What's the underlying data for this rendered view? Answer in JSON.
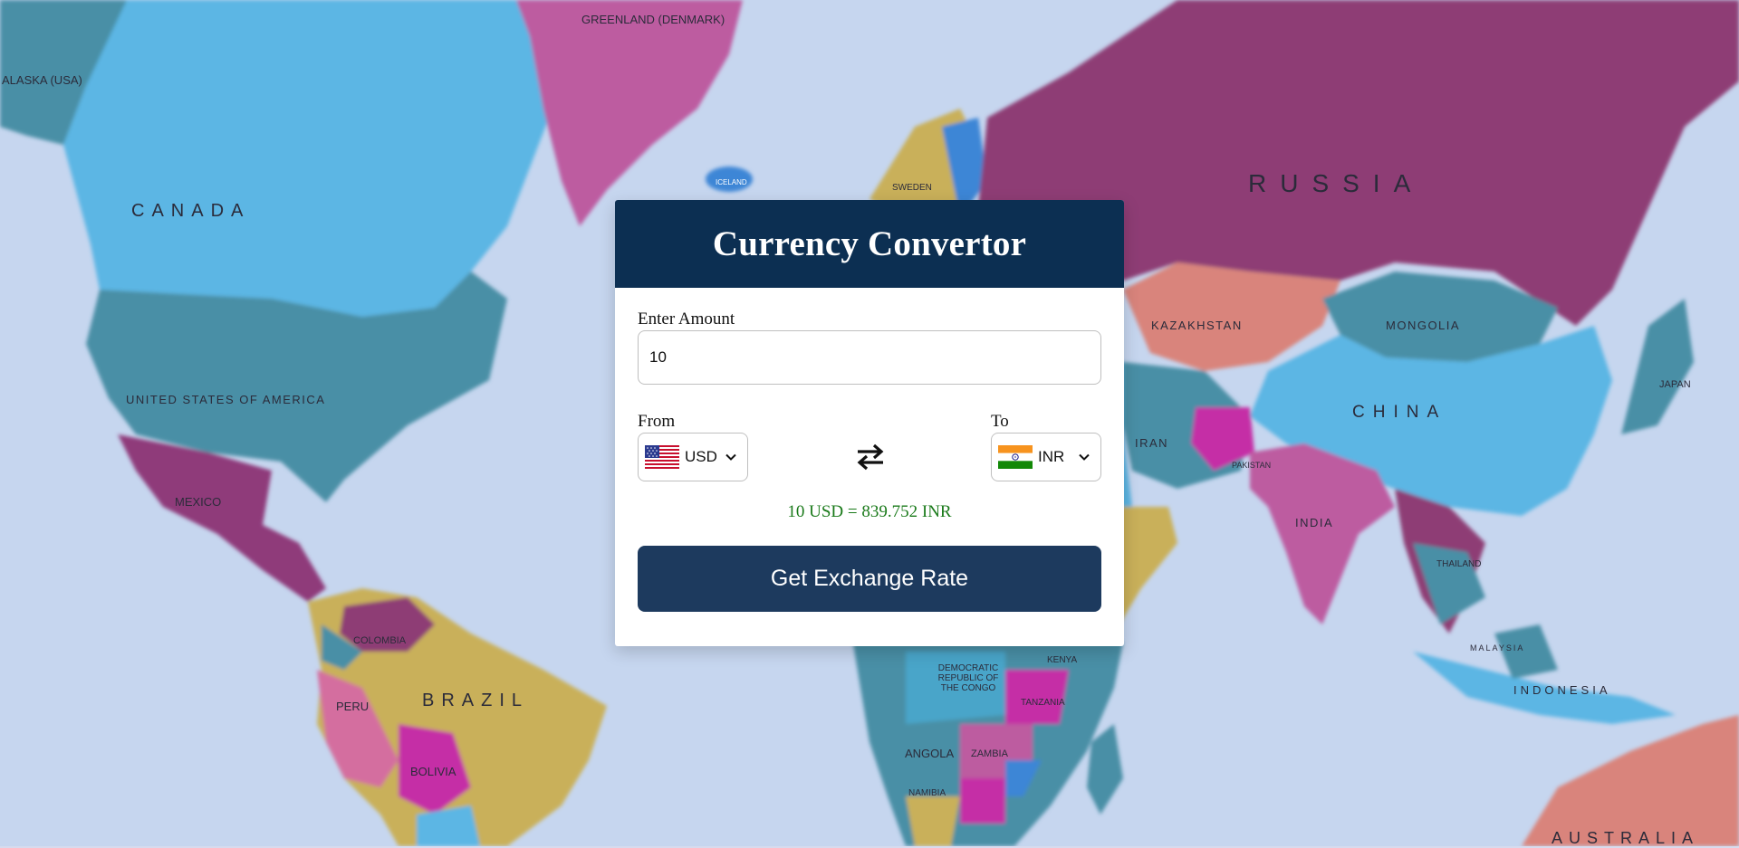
{
  "map": {
    "labels": {
      "alaska": "ALASKA (USA)",
      "greenland": "GREENLAND (DENMARK)",
      "canada": "CANADA",
      "usa": "UNITED STATES OF AMERICA",
      "mexico": "MEXICO",
      "russia": "RUSSIA",
      "kazakhstan": "KAZAKHSTAN",
      "mongolia": "MONGOLIA",
      "china": "CHINA",
      "iran": "IRAN",
      "india": "INDIA",
      "japan": "JAPAN",
      "brazil": "BRAZIL",
      "peru": "PERU",
      "bolivia": "BOLIVIA",
      "colombia": "COLOMBIA",
      "angola": "ANGOLA",
      "zambia": "ZAMBIA",
      "tanzania": "TANZANIA",
      "kenya": "KENYA",
      "namibia": "NAMIBIA",
      "indonesia": "INDONESIA",
      "australia": "AUSTRALIA",
      "sweden": "SWEDEN",
      "iceland": "ICELAND",
      "drc": "DEMOCRATIC REPUBLIC OF THE CONGO",
      "thailand": "THAILAND",
      "pakistan": "PAKISTAN",
      "malaysia": "MALAYSIA"
    }
  },
  "converter": {
    "title": "Currency Convertor",
    "amount_label": "Enter Amount",
    "amount_value": "10",
    "from_label": "From",
    "from_currency": "USD",
    "from_flag_icon": "us-flag-icon",
    "to_label": "To",
    "to_currency": "INR",
    "to_flag_icon": "india-flag-icon",
    "swap_icon": "swap-arrows-icon",
    "result": "10 USD = 839.752 INR",
    "button_label": "Get Exchange Rate"
  },
  "colors": {
    "header_bg": "#0c2f52",
    "button_bg": "#1d3a5e",
    "result_text": "#1a7a1a"
  }
}
